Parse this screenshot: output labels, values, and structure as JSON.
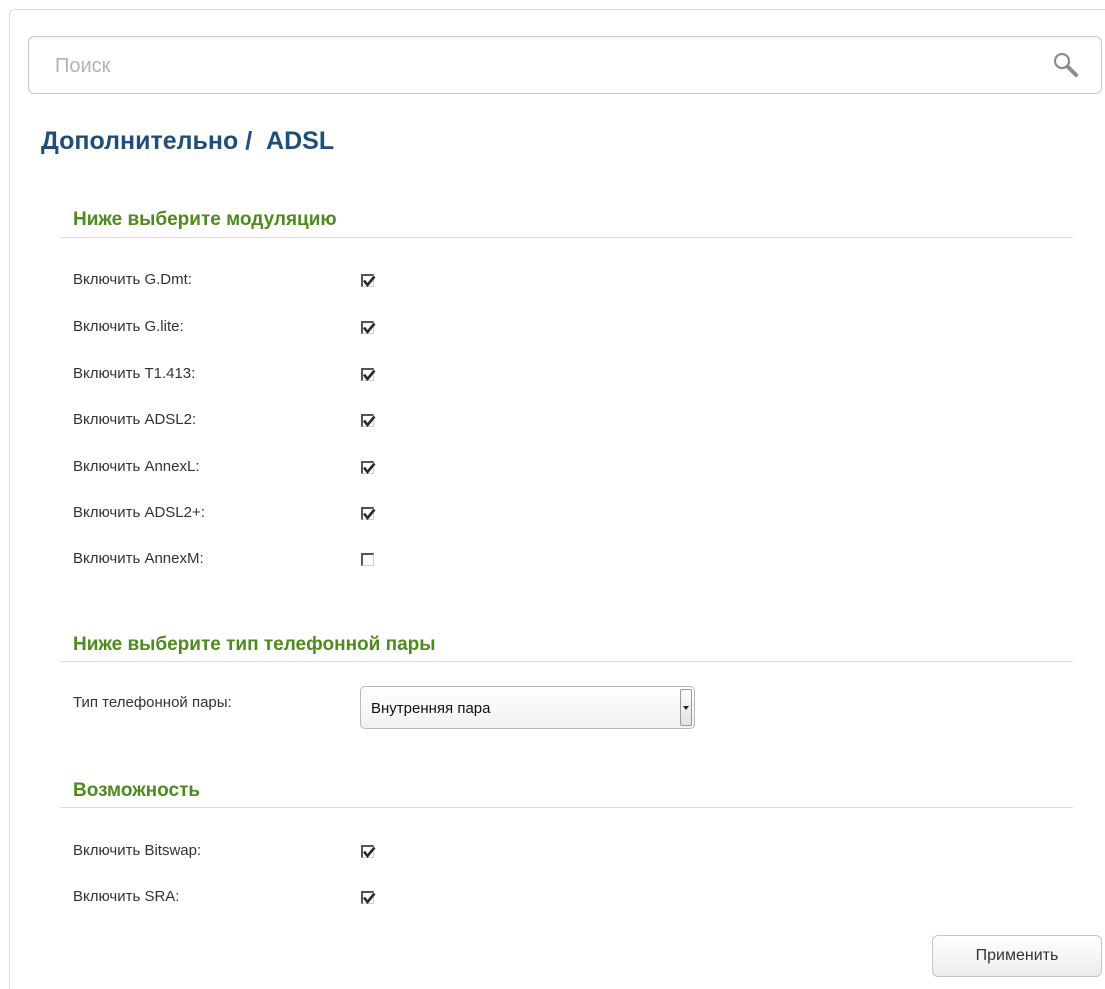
{
  "search": {
    "placeholder": "Поиск",
    "icon": "search-icon"
  },
  "page": {
    "title": "Дополнительно /  ADSL"
  },
  "colors": {
    "title": "#1f4e79",
    "section_title": "#4e8a1d",
    "label": "#333333"
  },
  "modulation": {
    "title": "Ниже выберите модуляцию",
    "items": [
      {
        "label": "Включить G.Dmt:",
        "checked": true
      },
      {
        "label": "Включить G.lite:",
        "checked": true
      },
      {
        "label": "Включить T1.413:",
        "checked": true
      },
      {
        "label": "Включить ADSL2:",
        "checked": true
      },
      {
        "label": "Включить AnnexL:",
        "checked": true
      },
      {
        "label": "Включить ADSL2+:",
        "checked": true
      },
      {
        "label": "Включить AnnexM:",
        "checked": false
      }
    ]
  },
  "phone_pair": {
    "title": "Ниже выберите тип телефонной пары",
    "label": "Тип телефонной пары:",
    "value": "Внутренняя пара"
  },
  "capability": {
    "title": "Возможность",
    "items": [
      {
        "label": "Включить Bitswap:",
        "checked": true
      },
      {
        "label": "Включить SRA:",
        "checked": true
      }
    ]
  },
  "actions": {
    "apply_label": "Применить"
  }
}
